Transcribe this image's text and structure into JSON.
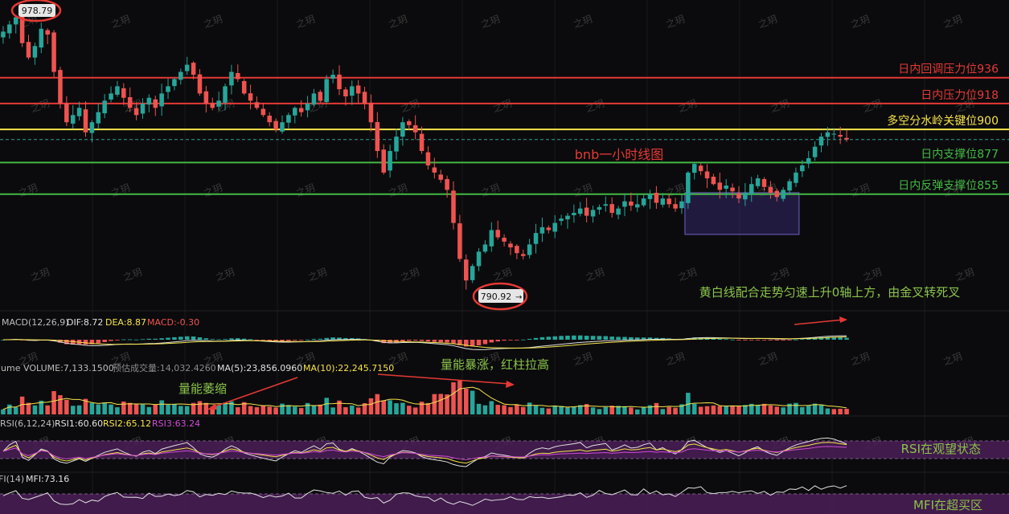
{
  "chart_data": {
    "type": "candlestick",
    "title": "bnb一小时线图",
    "watermark": "之玥",
    "extremes": {
      "high": "978.79",
      "low": "790.92",
      "low_arrow": "→"
    },
    "ylim": [
      775,
      990
    ],
    "horizontal_levels": [
      {
        "label": "日内回调压力位936",
        "value": 936,
        "color": "#e53935"
      },
      {
        "label": "日内压力位918",
        "value": 918,
        "color": "#e53935"
      },
      {
        "label": "多空分水岭关键位900",
        "value": 900,
        "color": "#f6e44b"
      },
      {
        "label": "日内支撑位877",
        "value": 877,
        "color": "#43b943"
      },
      {
        "label": "日内反弹支撑位855",
        "value": 855,
        "color": "#43b943"
      }
    ],
    "current_price_line": 893,
    "consolidation_box": {
      "from_index": 108,
      "to_index": 125,
      "low": 827,
      "high": 856
    },
    "price_path": [
      968,
      973,
      978,
      960,
      950,
      958,
      970,
      966,
      940,
      918,
      905,
      910,
      915,
      898,
      905,
      912,
      920,
      925,
      930,
      922,
      915,
      910,
      918,
      922,
      915,
      925,
      930,
      935,
      940,
      945,
      938,
      925,
      918,
      915,
      920,
      930,
      940,
      935,
      925,
      920,
      915,
      910,
      905,
      900,
      905,
      910,
      915,
      912,
      918,
      925,
      920,
      935,
      938,
      928,
      923,
      930,
      925,
      918,
      905,
      885,
      870,
      885,
      895,
      905,
      903,
      898,
      885,
      875,
      870,
      865,
      858,
      835,
      810,
      795,
      805,
      815,
      820,
      830,
      825,
      822,
      818,
      814,
      812,
      820,
      828,
      832,
      830,
      835,
      838,
      840,
      842,
      845,
      840,
      844,
      846,
      848,
      842,
      845,
      850,
      847,
      848,
      852,
      855,
      849,
      852,
      848,
      845,
      850,
      870,
      876,
      871,
      866,
      862,
      858,
      861,
      857,
      852,
      856,
      862,
      866,
      860,
      856,
      853,
      858,
      864,
      870,
      875,
      880,
      888,
      895,
      898,
      897,
      895,
      893
    ],
    "macd": {
      "params": "MACD(12,26,9)",
      "dif_label": "DIF:8.72",
      "dea_label": "DEA:8.87",
      "macd_label": "MACD:-0.30"
    },
    "volume": {
      "label_main": "lume  VOLUME:7,133.1500",
      "label_est": "预估成交量:14,032.4260",
      "label_ma5": "MA(5):23,856.0960",
      "label_ma10": "MA(10):22,245.7150"
    },
    "rsi": {
      "params": "RSI(6,12,24)",
      "rsi1_label": "RSI1:60.60",
      "rsi2_label": "RSI2:65.12",
      "rsi3_label": "RSI3:63.24",
      "note": "RSI在观望状态"
    },
    "mfi": {
      "params": "FI(14)",
      "mfi_label": "MFI:73.16",
      "note": "MFI在超买区"
    },
    "annotations": {
      "shrink": "量能萎缩",
      "surge": "量能暴涨，红柱拉高",
      "macd_note": "黄白线配合走势匀速上升0轴上方，由金叉转死叉"
    },
    "colors": {
      "up": "#26a69a",
      "down": "#ef5350",
      "red_text": "#e53935",
      "yellow": "#f6e44b",
      "green": "#43b943",
      "purple_band": "#4a1f57"
    }
  }
}
